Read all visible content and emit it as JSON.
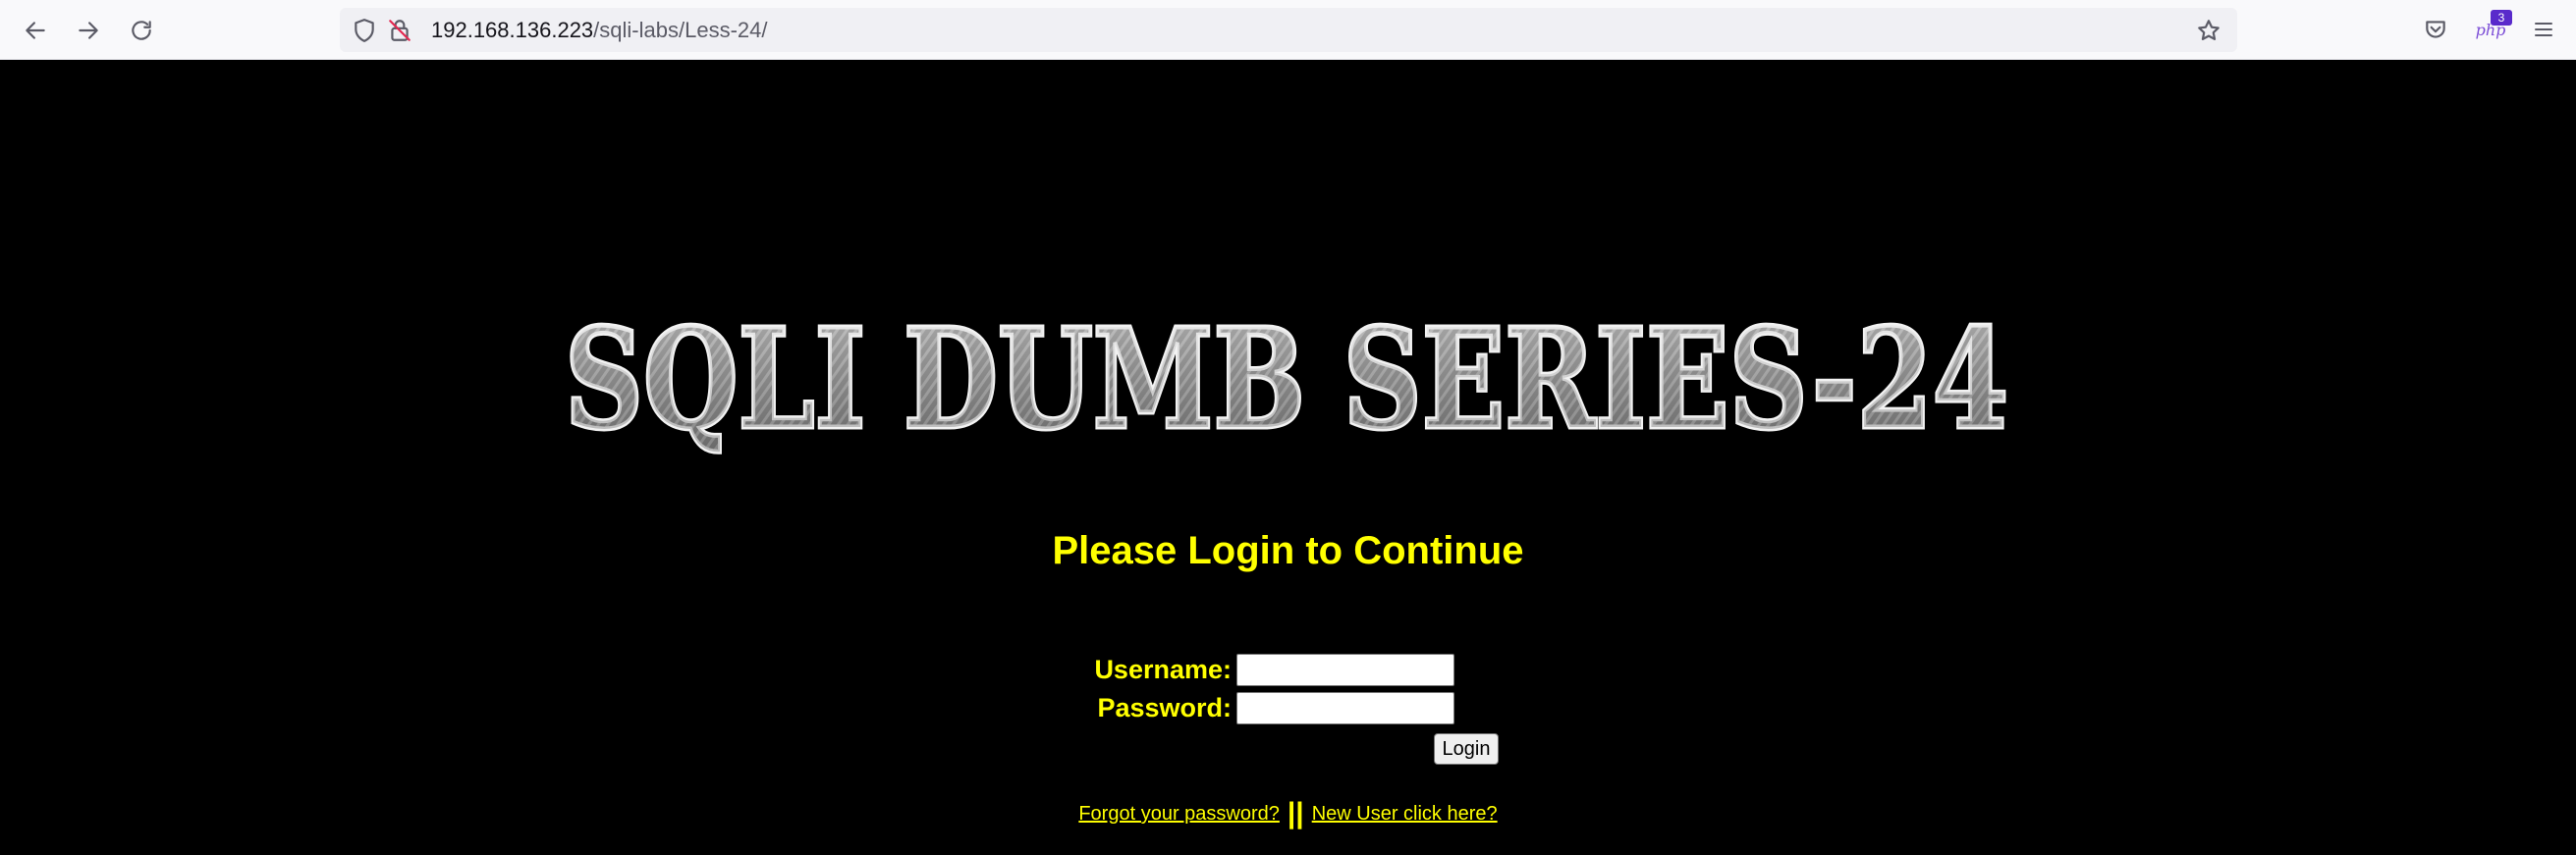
{
  "browser": {
    "url_host": "192.168.136.223",
    "url_path": "/sqli-labs/Less-24/",
    "extension_badge": "3",
    "extension_label": "php"
  },
  "page": {
    "banner_text": "SQLI DUMB SERIES-24",
    "heading": "Please Login to Continue",
    "username_label": "Username:",
    "password_label": "Password:",
    "username_value": "",
    "password_value": "",
    "login_button": "Login",
    "forgot_link": "Forgot your password?",
    "separator": "||",
    "new_user_link": "New User click here?"
  },
  "colors": {
    "background": "#000000",
    "accent_text": "#ffff00"
  }
}
